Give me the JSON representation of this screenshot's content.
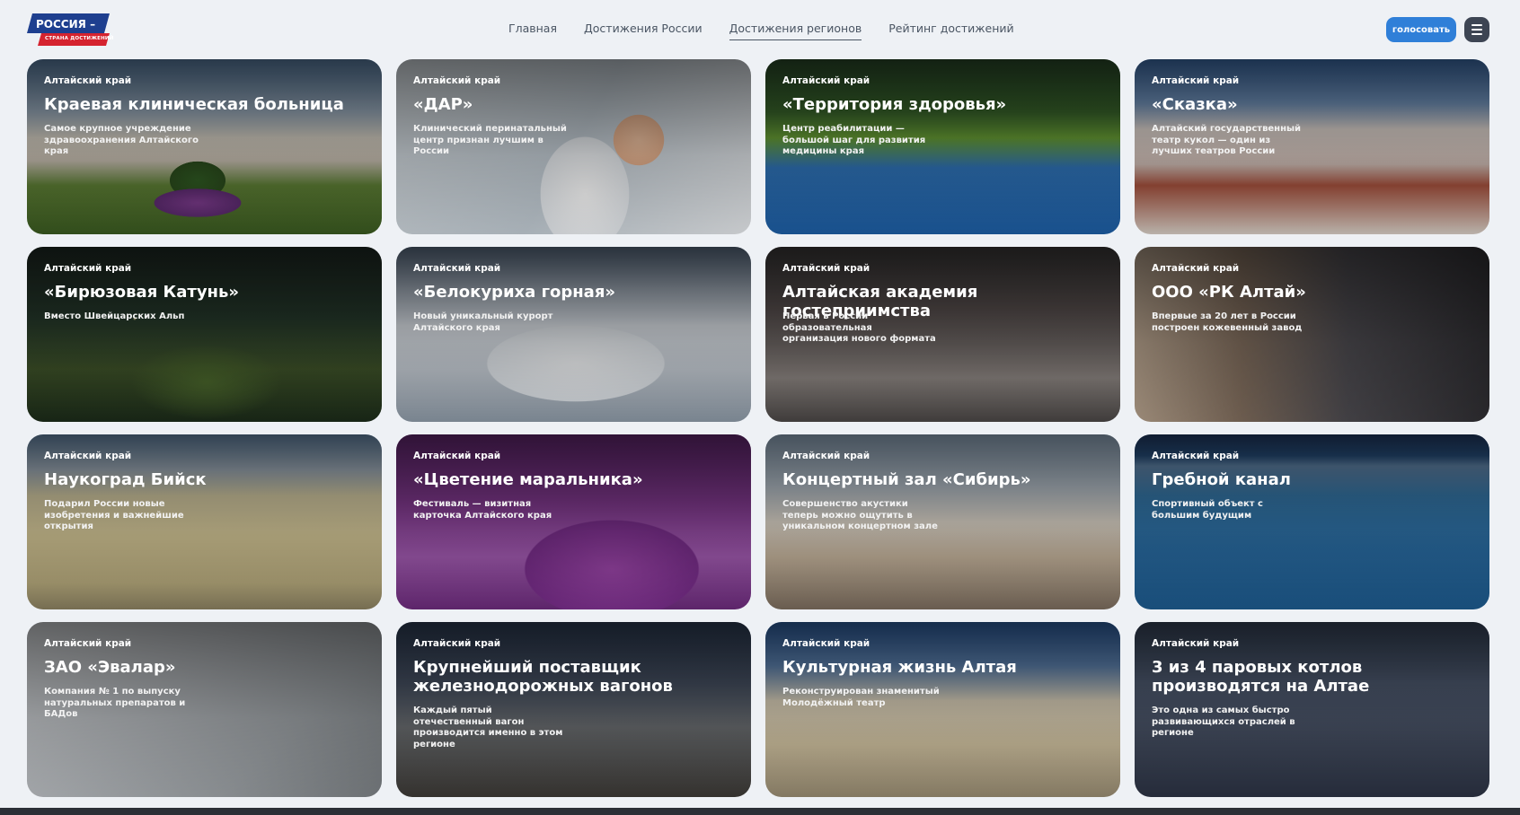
{
  "logo": {
    "main": "РОССИЯ –",
    "sub": "СТРАНА ДОСТИЖЕНИЙ"
  },
  "nav": [
    {
      "label": "Главная",
      "active": false
    },
    {
      "label": "Достижения России",
      "active": false
    },
    {
      "label": "Достижения регионов",
      "active": true
    },
    {
      "label": "Рейтинг достижений",
      "active": false
    }
  ],
  "vote_label": "голосовать",
  "colors": {
    "accent": "#2f7fd8",
    "menu": "#3d4553",
    "page_bg": "#eef1f5"
  },
  "cards": [
    {
      "region": "Алтайский край",
      "title": "Краевая клиническая больница",
      "desc": "Самое крупное учреждение здравоохранения Алтайского края",
      "bg": "bg-hospital",
      "lines": 1
    },
    {
      "region": "Алтайский край",
      "title": "«ДАР»",
      "desc": "Клинический перинатальный центр признан лучшим в России",
      "bg": "bg-dar",
      "lines": 1
    },
    {
      "region": "Алтайский край",
      "title": "«Территория здоровья»",
      "desc": "Центр реабилитации — большой шаг для развития медицины края",
      "bg": "bg-health",
      "lines": 1
    },
    {
      "region": "Алтайский край",
      "title": "«Сказка»",
      "desc": "Алтайский государственный театр кукол — один из лучших театров России",
      "bg": "bg-skazka",
      "lines": 1
    },
    {
      "region": "Алтайский край",
      "title": "«Бирюзовая Катунь»",
      "desc": "Вместо Швейцарских Альп",
      "bg": "bg-katun",
      "lines": 1
    },
    {
      "region": "Алтайский край",
      "title": "«Белокуриха горная»",
      "desc": "Новый уникальный курорт Алтайского края",
      "bg": "bg-belokuriha",
      "lines": 1
    },
    {
      "region": "Алтайский край",
      "title": "Алтайская академия гостеприимства",
      "desc": "Первая в России образовательная организация нового формата",
      "bg": "bg-academy",
      "lines": 1
    },
    {
      "region": "Алтайский край",
      "title": "ООО «РК Алтай»",
      "desc": "Впервые за 20 лет в России построен кожевенный завод",
      "bg": "bg-rk",
      "lines": 1
    },
    {
      "region": "Алтайский край",
      "title": "Наукоград Бийск",
      "desc": "Подарил России новые изобретения и важнейшие открытия",
      "bg": "bg-biysk",
      "lines": 1
    },
    {
      "region": "Алтайский край",
      "title": "«Цветение маральника»",
      "desc": "Фестиваль — визитная карточка Алтайского края",
      "bg": "bg-maralnik",
      "lines": 1
    },
    {
      "region": "Алтайский край",
      "title": "Концертный зал «Сибирь»",
      "desc": "Совершенство акустики теперь можно ощутить в уникальном концертном зале",
      "bg": "bg-sibir",
      "lines": 1
    },
    {
      "region": "Алтайский край",
      "title": "Гребной канал",
      "desc": "Спортивный объект с большим будущим",
      "bg": "bg-kanal",
      "lines": 1
    },
    {
      "region": "Алтайский край",
      "title": "ЗАО «Эвалар»",
      "desc": "Компания № 1 по выпуску натуральных препаратов и БАДов",
      "bg": "bg-evalar",
      "lines": 1
    },
    {
      "region": "Алтайский край",
      "title": "Крупнейший поставщик железнодорожных вагонов",
      "desc": "Каждый пятый отечественный вагон производится именно в этом регионе",
      "bg": "bg-vagony",
      "lines": 2
    },
    {
      "region": "Алтайский край",
      "title": "Культурная жизнь Алтая",
      "desc": "Реконструирован знаменитый Молодёжный театр",
      "bg": "bg-kultura",
      "lines": 1
    },
    {
      "region": "Алтайский край",
      "title": "3 из 4 паровых котлов производятся на Алтае",
      "desc": "Это одна из самых быстро развивающихся отраслей в регионе",
      "bg": "bg-kotly",
      "lines": 2
    }
  ]
}
